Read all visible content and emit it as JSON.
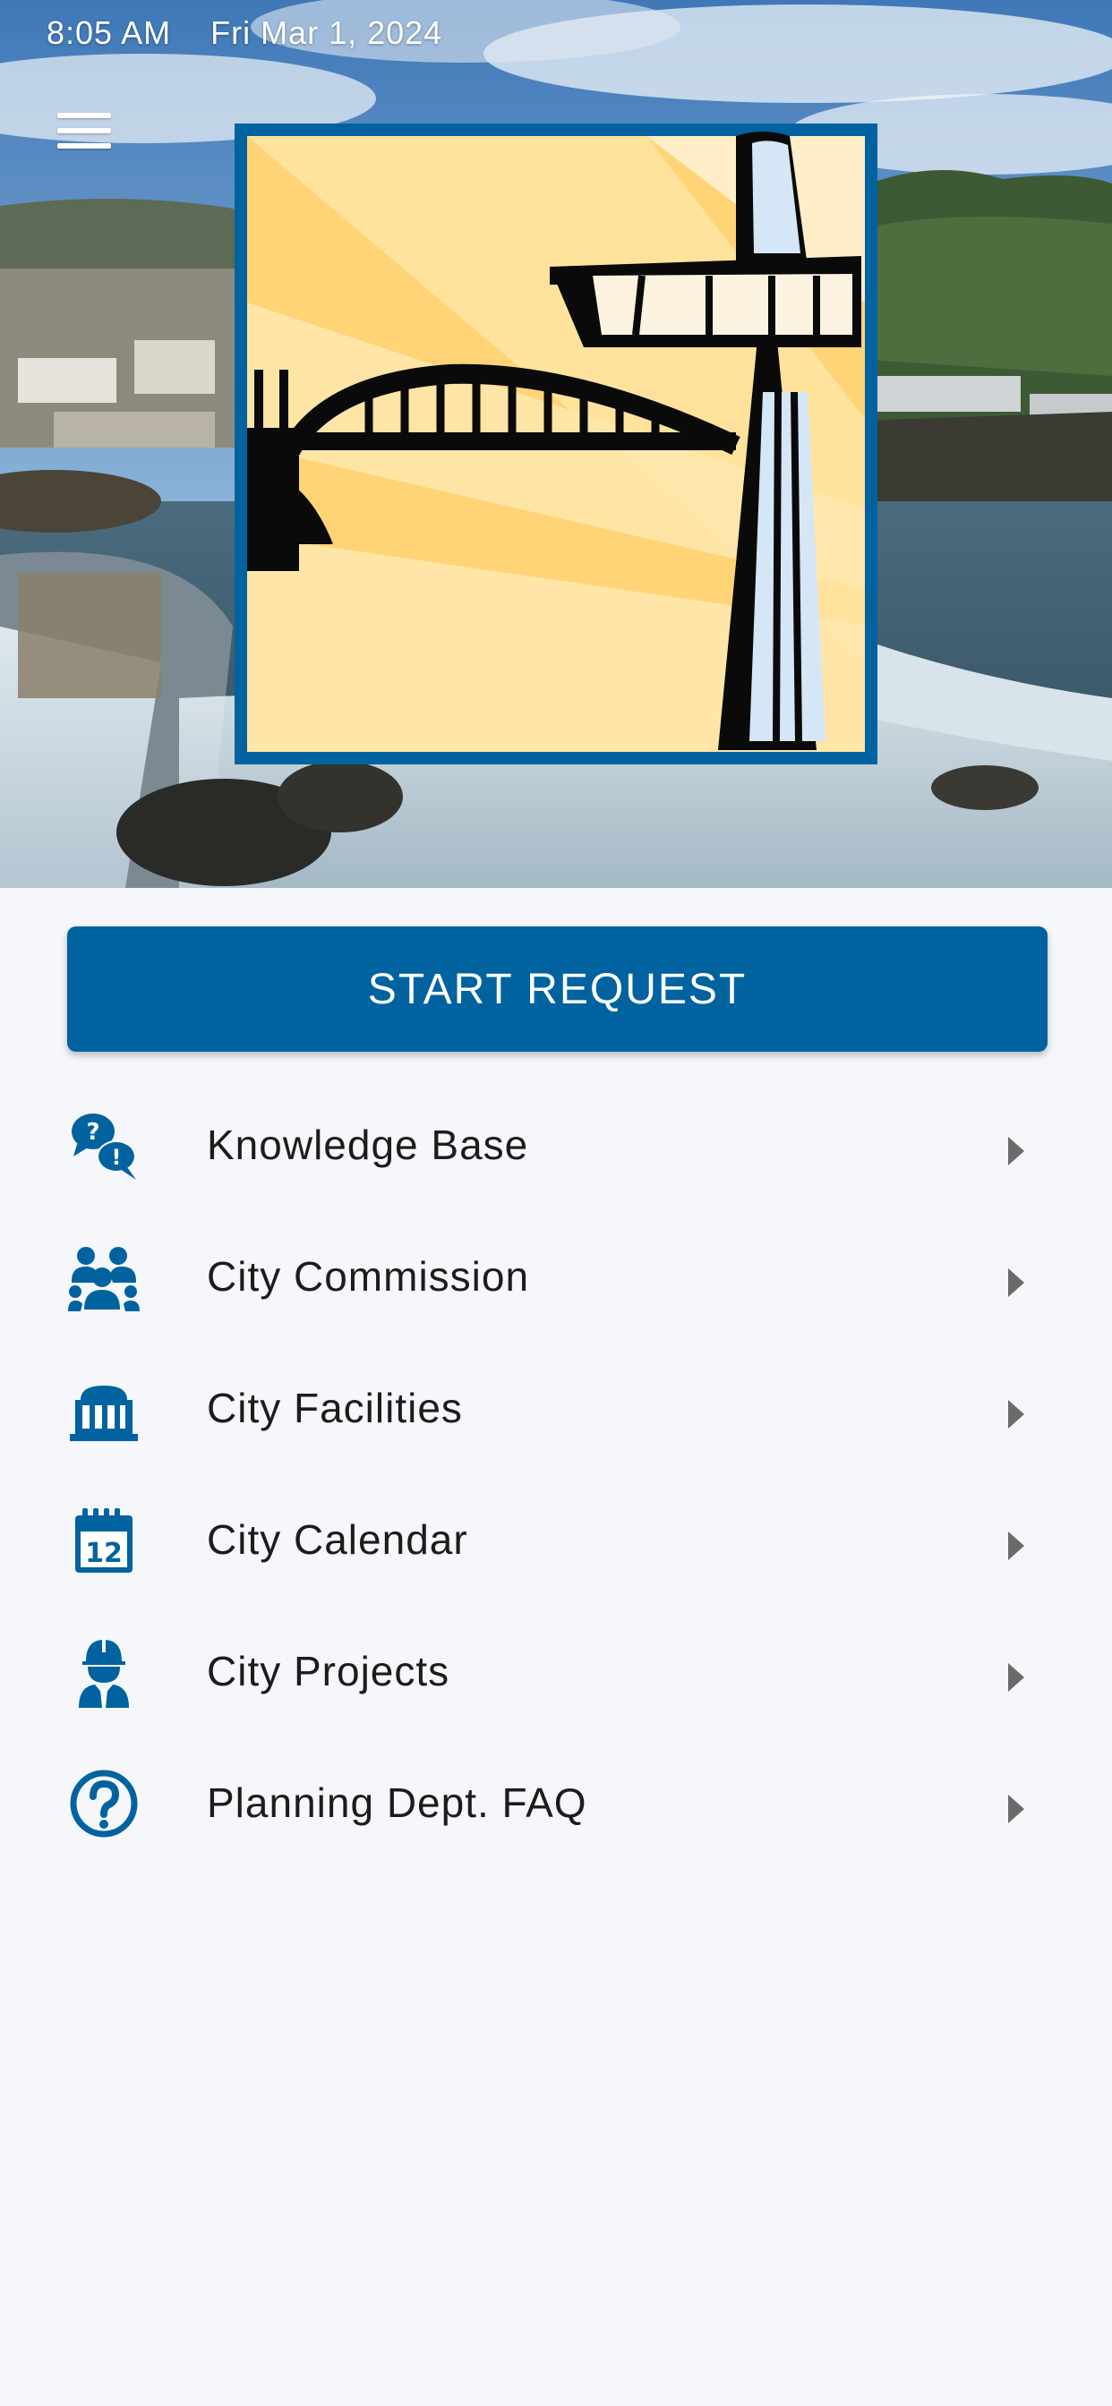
{
  "status_bar": {
    "time": "8:05 AM",
    "date": "Fri Mar 1, 2024"
  },
  "header": {
    "menu_icon": "hamburger-icon",
    "logo_icon": "city-logo-bridge-elevator"
  },
  "start_request": {
    "label": "START REQUEST"
  },
  "menu": {
    "items": [
      {
        "label": "Knowledge Base",
        "icon": "question-chat-icon"
      },
      {
        "label": "City Commission",
        "icon": "group-icon"
      },
      {
        "label": "City Facilities",
        "icon": "building-icon"
      },
      {
        "label": "City Calendar",
        "icon": "calendar-icon"
      },
      {
        "label": "City Projects",
        "icon": "worker-icon"
      },
      {
        "label": "Planning Dept. FAQ",
        "icon": "question-circle-icon"
      }
    ]
  },
  "colors": {
    "accent": "#00639f",
    "background": "#f5f7fa",
    "text": "#1c1c1c",
    "chevron": "#6b6b6b",
    "logo_yellow": "#ffd477"
  }
}
